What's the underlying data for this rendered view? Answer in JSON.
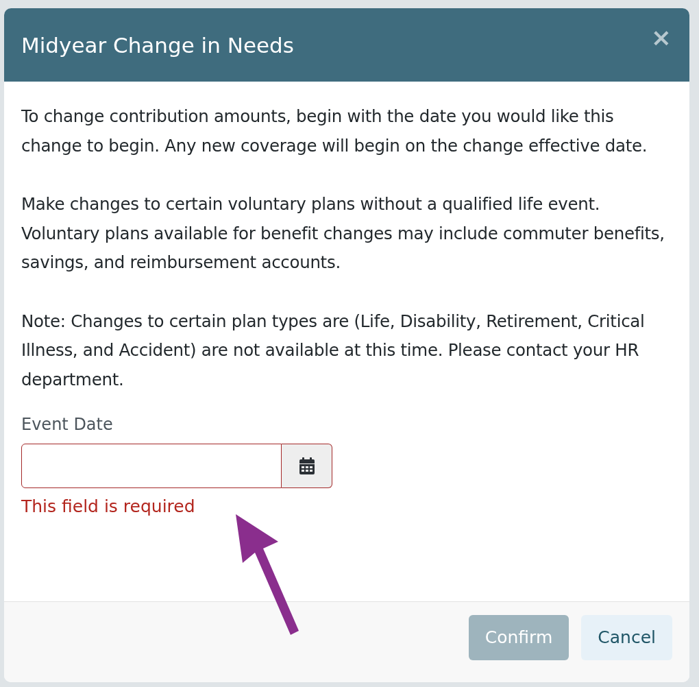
{
  "dialog": {
    "title": "Midyear Change in Needs",
    "close": "×",
    "paragraphs": [
      "To change contribution amounts, begin with the date you would like this change to begin. Any new coverage will begin on the change effective date.",
      "Make changes to certain voluntary plans without a qualified life event. Voluntary plans available for benefit changes may include commuter benefits, savings, and reimbursement accounts.",
      "Note: Changes to certain plan types are (Life, Disability, Retirement, Critical Illness, and Accident) are not available at this time. Please contact your HR department."
    ],
    "field": {
      "label": "Event Date",
      "invalid": true,
      "error": "This field is required"
    },
    "buttons": [
      {
        "label": "Confirm",
        "kind": "primary",
        "disabled": true
      },
      {
        "label": "Cancel",
        "kind": "secondary",
        "disabled": false
      }
    ]
  }
}
